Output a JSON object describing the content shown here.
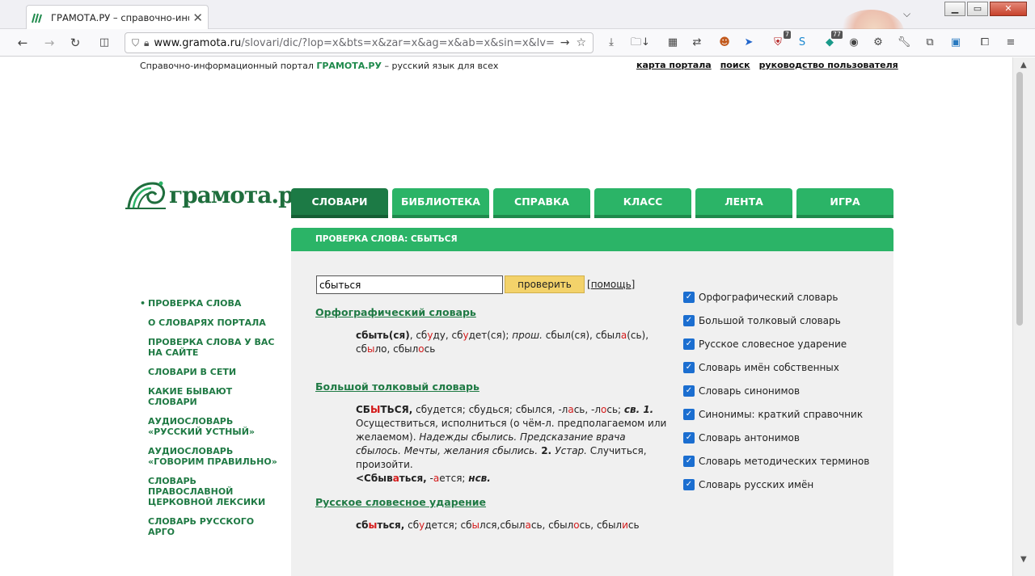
{
  "browser": {
    "tab_title": "ГРАМОТА.РУ – справочно-инфор",
    "url_host": "www.gramota.ru",
    "url_path": "/slovari/dic/?lop=x&bts=x&zar=x&ag=x&ab=x&sin=x&lv=x&az",
    "ext_badge_1": "7",
    "ext_badge_2": "77"
  },
  "header": {
    "tagline_prefix": "Справочно-информационный портал ",
    "tagline_brand": "ГРАМОТА.РУ",
    "tagline_suffix": " – русский язык для всех",
    "links": [
      "карта портала",
      "поиск",
      "руководство пользователя"
    ]
  },
  "logo": {
    "text": "грамота.ру"
  },
  "menu": [
    "СЛОВАРИ",
    "БИБЛИОТЕКА",
    "СПРАВКА",
    "КЛАСС",
    "ЛЕНТА",
    "ИГРА"
  ],
  "section_title": "ПРОВЕРКА СЛОВА: СБЫТЬСЯ",
  "sidebar": [
    "ПРОВЕРКА СЛОВА",
    "О СЛОВАРЯХ ПОРТАЛА",
    "ПРОВЕРКА СЛОВА У ВАС НА САЙТЕ",
    "СЛОВАРИ В СЕТИ",
    "КАКИЕ БЫВАЮТ СЛОВАРИ",
    "АУДИОСЛОВАРЬ «РУССКИЙ УСТНЫЙ»",
    "АУДИОСЛОВАРЬ «ГОВОРИМ ПРАВИЛЬНО»",
    "СЛОВАРЬ ПРАВОСЛАВНОЙ ЦЕРКОВНОЙ ЛЕКСИКИ",
    "СЛОВАРЬ РУССКОГО АРГО"
  ],
  "search": {
    "value": "сбыться",
    "button": "проверить",
    "help": "помощь"
  },
  "dictionaries": [
    "Орфографический словарь",
    "Большой толковый словарь",
    "Русское словесное ударение"
  ],
  "entries": {
    "orfo": {
      "head": "сбыть(ся)",
      "p1": ", сб",
      "a1": "у",
      "p2": "ду, сб",
      "a2": "у",
      "p3": "дет(ся); ",
      "prosh": "прош.",
      "p4": " сбыл(ся), сбыл",
      "a4": "а",
      "p5": "(сь), сб",
      "a5": "ы",
      "p6": "ло, сбыл",
      "a6": "о",
      "p7": "сь"
    },
    "btd": {
      "head_1": "СБ",
      "head_a": "Ы",
      "head_2": "ТЬСЯ,",
      "t1": " сбудется; сбудься; сбылся, -л",
      "a1": "а",
      "t2": "сь, -л",
      "a2": "о",
      "t3": "сь; ",
      "gram": "св. 1.",
      "t4": " Осуществиться, исполниться (о чём-л. предполагаемом или желаемом). ",
      "ex1": "Надежды сбылись. Предсказание врача сбылось. Мечты, желания сбылись.",
      "n2": " 2. ",
      "ustar": "Устар.",
      "t5": " Случиться, произойти. ",
      "der_1": "<Сбыв",
      "der_a": "а",
      "der_2": "ться,",
      "t6": " -",
      "a6": "а",
      "t7": "ется; ",
      "nsv": "нсв."
    },
    "udar": {
      "head_1": "сб",
      "head_a": "ы",
      "head_2": "ться,",
      "t1": " сб",
      "a1": "у",
      "t2": "дется; сб",
      "a2": "ы",
      "t3": "лся,сбыл",
      "a3": "а",
      "t4": "сь, сбыл",
      "a4": "о",
      "t5": "сь, сбыл",
      "a5": "и",
      "t6": "сь"
    }
  },
  "checkboxes": [
    "Орфографический словарь",
    "Большой толковый словарь",
    "Русское словесное ударение",
    "Словарь имён собственных",
    "Словарь синонимов",
    "Синонимы: краткий справочник",
    "Словарь антонимов",
    "Словарь методических терминов",
    "Словарь русских имён"
  ],
  "colors": {
    "brand_green": "#2bb467",
    "active_green": "#1c7a45",
    "link_green": "#1f7a44",
    "accent_red": "#d41a1a",
    "button_yellow": "#f3d26a"
  }
}
